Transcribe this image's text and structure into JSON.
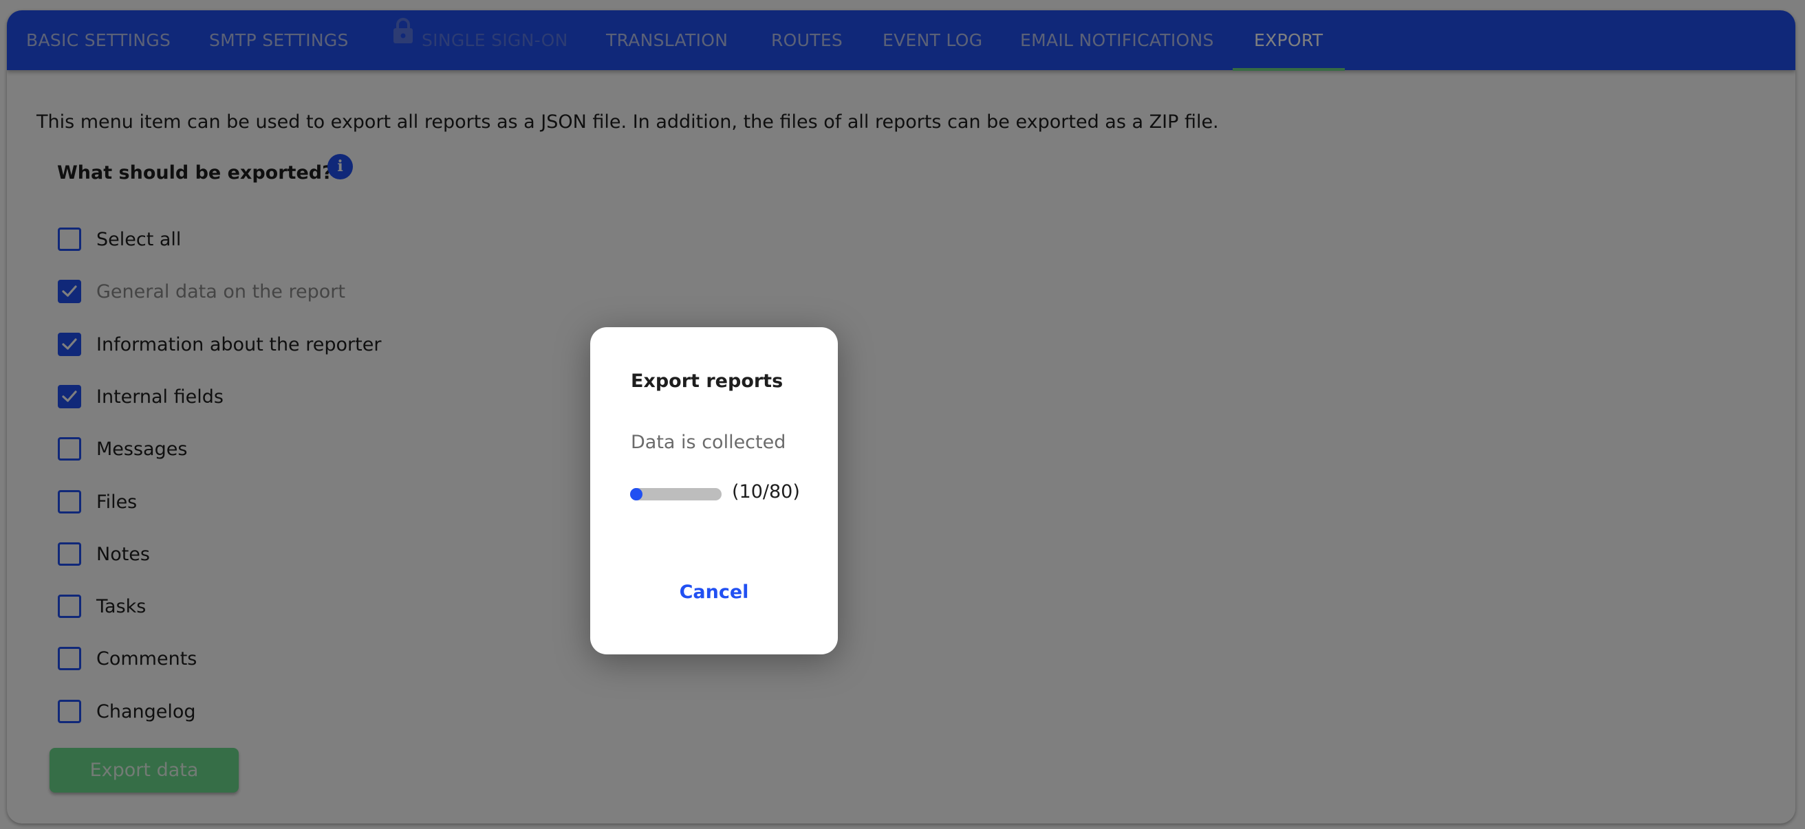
{
  "tabs": [
    {
      "label": "BASIC SETTINGS",
      "state": "normal"
    },
    {
      "label": "SMTP SETTINGS",
      "state": "normal"
    },
    {
      "label": "SINGLE SIGN-ON",
      "state": "disabled",
      "icon": "lock-icon"
    },
    {
      "label": "TRANSLATION",
      "state": "normal"
    },
    {
      "label": "ROUTES",
      "state": "normal"
    },
    {
      "label": "EVENT LOG",
      "state": "normal"
    },
    {
      "label": "EMAIL NOTIFICATIONS",
      "state": "normal"
    },
    {
      "label": "EXPORT",
      "state": "active"
    }
  ],
  "main": {
    "description": "This menu item can be used to export all reports as a JSON file. In addition, the files of all reports can be exported as a ZIP file.",
    "section_heading": "What should be exported?",
    "info_icon": "info-icon",
    "options": [
      {
        "label": "Select all",
        "checked": false,
        "disabled": false
      },
      {
        "label": "General data on the report",
        "checked": true,
        "disabled": true
      },
      {
        "label": "Information about the reporter",
        "checked": true,
        "disabled": false
      },
      {
        "label": "Internal fields",
        "checked": true,
        "disabled": false
      },
      {
        "label": "Messages",
        "checked": false,
        "disabled": false
      },
      {
        "label": "Files",
        "checked": false,
        "disabled": false
      },
      {
        "label": "Notes",
        "checked": false,
        "disabled": false
      },
      {
        "label": "Tasks",
        "checked": false,
        "disabled": false
      },
      {
        "label": "Comments",
        "checked": false,
        "disabled": false
      },
      {
        "label": "Changelog",
        "checked": false,
        "disabled": false
      }
    ],
    "export_button_label": "Export data"
  },
  "dialog": {
    "title": "Export reports",
    "status": "Data is collected",
    "progress_current": 10,
    "progress_total": 80,
    "progress_text": "(10/80)",
    "cancel_label": "Cancel"
  },
  "colors": {
    "primary": "#2150f2",
    "success": "#6cdc8e",
    "active_tab_indicator": "#6ed889"
  }
}
